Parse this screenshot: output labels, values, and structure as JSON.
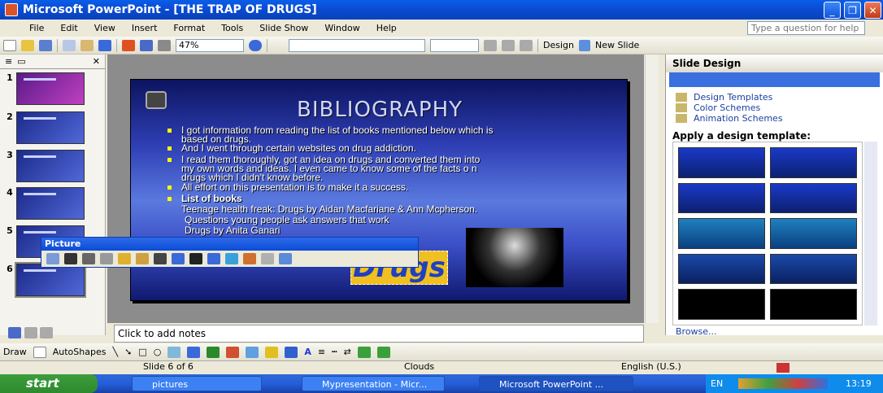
{
  "window": {
    "title": "Microsoft PowerPoint - [THE TRAP OF DRUGS]"
  },
  "menu": [
    "File",
    "Edit",
    "View",
    "Insert",
    "Format",
    "Tools",
    "Slide Show",
    "Window",
    "Help"
  ],
  "help": {
    "placeholder": "Type a question for help"
  },
  "toolbar": {
    "zoom": "47%",
    "design": "Design",
    "new_slide": "New Slide"
  },
  "thumbnails": [
    "1",
    "2",
    "3",
    "4",
    "5",
    "6"
  ],
  "slide": {
    "title": "BIBLIOGRAPHY",
    "bullets": [
      "I got information from reading the list of books mentioned below which is",
      "based on drugs.",
      "And I went through certain websites on drug addiction.",
      "I read them thoroughly, got an idea on drugs and converted them into",
      "my own words and ideas. I even came to know some of the facts o n",
      "drugs which I didn't know before.",
      "All effort on this presentation is to make it a success.",
      "List of books",
      "Teenage health freak: Drugs by  Aidan Macfariane & Ann Mcpherson.",
      "Questions young people ask answers that work",
      "Drugs by Anita Ganari"
    ],
    "drugs_word": "Drugs"
  },
  "picture_toolbar": {
    "title": "Picture"
  },
  "taskpane": {
    "title": "Slide Design",
    "links": [
      "Design Templates",
      "Color Schemes",
      "Animation Schemes"
    ],
    "apply_heading": "Apply a design template:",
    "browse": "Browse..."
  },
  "notes": {
    "placeholder": "Click to add notes"
  },
  "drawbar": {
    "draw": "Draw",
    "autoshapes": "AutoShapes"
  },
  "status": {
    "slide": "Slide 6 of 6",
    "design": "Clouds",
    "language": "English (U.S.)"
  },
  "taskbar": {
    "start": "start",
    "tasks": [
      "pictures",
      "Mypresentation - Micr...",
      "Microsoft PowerPoint ..."
    ],
    "lang": "EN",
    "clock": "13:19"
  }
}
